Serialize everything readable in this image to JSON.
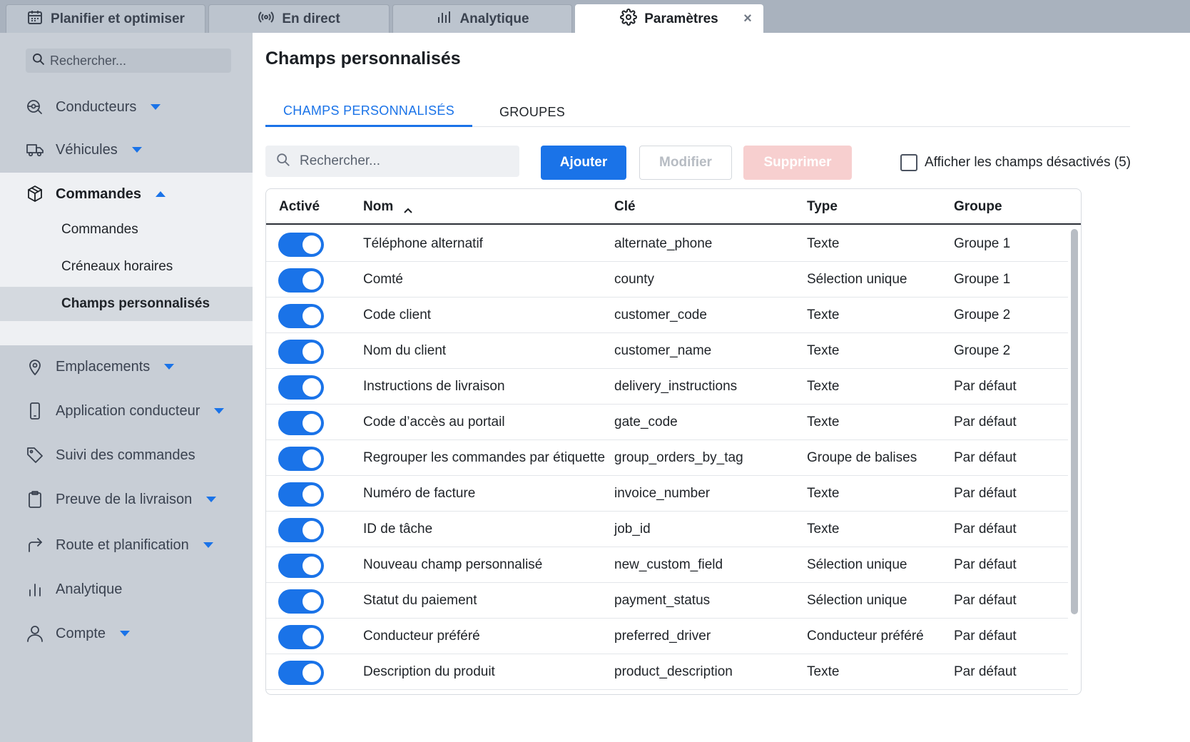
{
  "tabs": [
    {
      "label": "Planifier et optimiser",
      "icon": "calendar-icon"
    },
    {
      "label": "En direct",
      "icon": "broadcast-icon"
    },
    {
      "label": "Analytique",
      "icon": "bar-chart-icon"
    },
    {
      "label": "Paramètres",
      "icon": "gear-icon",
      "active": true
    }
  ],
  "tab_close": "×",
  "sidebar": {
    "search_placeholder": "Rechercher...",
    "items": [
      {
        "label": "Conducteurs",
        "icon": "steering-icon"
      },
      {
        "label": "Véhicules",
        "icon": "truck-icon"
      },
      {
        "label": "Commandes",
        "icon": "package-icon"
      },
      {
        "label": "Emplacements",
        "icon": "location-pin-icon"
      },
      {
        "label": "Application conducteur",
        "icon": "phone-icon"
      },
      {
        "label": "Suivi des commandes",
        "icon": "tag-icon"
      },
      {
        "label": "Preuve de la livraison",
        "icon": "clipboard-icon"
      },
      {
        "label": "Route et planification",
        "icon": "route-arrow-icon"
      },
      {
        "label": "Analytique",
        "icon": "bar-chart-icon"
      },
      {
        "label": "Compte",
        "icon": "user-icon"
      }
    ],
    "sub_items": [
      "Commandes",
      "Créneaux horaires",
      "Champs personnalisés"
    ]
  },
  "main": {
    "title": "Champs personnalisés",
    "subtabs": [
      "CHAMPS PERSONNALISÉS",
      "GROUPES"
    ],
    "search_placeholder": "Rechercher...",
    "buttons": {
      "add": "Ajouter",
      "edit": "Modifier",
      "delete": "Supprimer"
    },
    "show_disabled": "Afficher les champs désactivés (5)",
    "columns": [
      "Activé",
      "Nom",
      "Clé",
      "Type",
      "Groupe"
    ],
    "rows": [
      {
        "enabled": true,
        "name": "Téléphone alternatif",
        "key": "alternate_phone",
        "type": "Texte",
        "group": "Groupe 1"
      },
      {
        "enabled": true,
        "name": "Comté",
        "key": "county",
        "type": "Sélection unique",
        "group": "Groupe 1"
      },
      {
        "enabled": true,
        "name": "Code client",
        "key": "customer_code",
        "type": "Texte",
        "group": "Groupe 2"
      },
      {
        "enabled": true,
        "name": "Nom du client",
        "key": "customer_name",
        "type": "Texte",
        "group": "Groupe 2"
      },
      {
        "enabled": true,
        "name": "Instructions de livraison",
        "key": "delivery_instructions",
        "type": "Texte",
        "group": "Par défaut"
      },
      {
        "enabled": true,
        "name": "Code d’accès au portail",
        "key": "gate_code",
        "type": "Texte",
        "group": "Par défaut"
      },
      {
        "enabled": true,
        "name": "Regrouper les commandes par étiquette",
        "key": "group_orders_by_tag",
        "type": "Groupe de balises",
        "group": "Par défaut"
      },
      {
        "enabled": true,
        "name": "Numéro de facture",
        "key": "invoice_number",
        "type": "Texte",
        "group": "Par défaut"
      },
      {
        "enabled": true,
        "name": "ID de tâche",
        "key": "job_id",
        "type": "Texte",
        "group": "Par défaut"
      },
      {
        "enabled": true,
        "name": "Nouveau champ personnalisé",
        "key": "new_custom_field",
        "type": "Sélection unique",
        "group": "Par défaut"
      },
      {
        "enabled": true,
        "name": "Statut du paiement",
        "key": "payment_status",
        "type": "Sélection unique",
        "group": "Par défaut"
      },
      {
        "enabled": true,
        "name": "Conducteur préféré",
        "key": "preferred_driver",
        "type": "Conducteur préféré",
        "group": "Par défaut"
      },
      {
        "enabled": true,
        "name": "Description du produit",
        "key": "product_description",
        "type": "Texte",
        "group": "Par défaut"
      }
    ]
  },
  "colors": {
    "accent": "#1a73e8",
    "danger_disabled": "#f7cfcf"
  }
}
